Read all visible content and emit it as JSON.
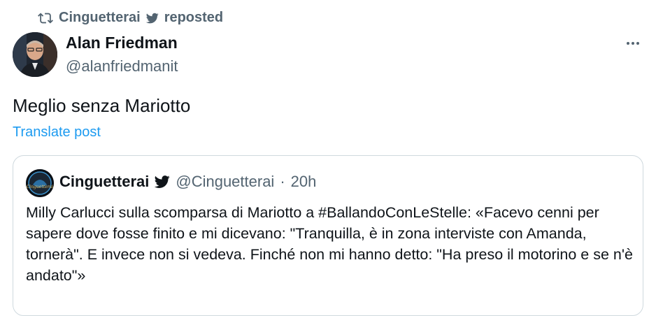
{
  "repost": {
    "label": "Cinguetterai",
    "action": "reposted"
  },
  "author": {
    "name": "Alan Friedman",
    "handle": "@alanfriedmanit"
  },
  "post": {
    "text": "Meglio senza Mariotto",
    "translate_label": "Translate post"
  },
  "quoted": {
    "name": "Cinguetterai",
    "handle": "@Cinguetterai",
    "separator": "·",
    "time": "20h",
    "avatar_text": "Cinguetterai",
    "text": "Milly Carlucci sulla scomparsa di Mariotto a #BallandoConLeStelle: «Facevo cenni per sapere dove fosse finito e mi dicevano: \"Tranquilla, è in zona interviste con Amanda, tornerà\". E invece non si vedeva. Finché non mi hanno detto: \"Ha preso il motorino e se n'è andato\"»"
  },
  "icons": {
    "repost": "repost-icon",
    "verified": "verified-bird-icon",
    "more": "more-horizontal-icon"
  }
}
